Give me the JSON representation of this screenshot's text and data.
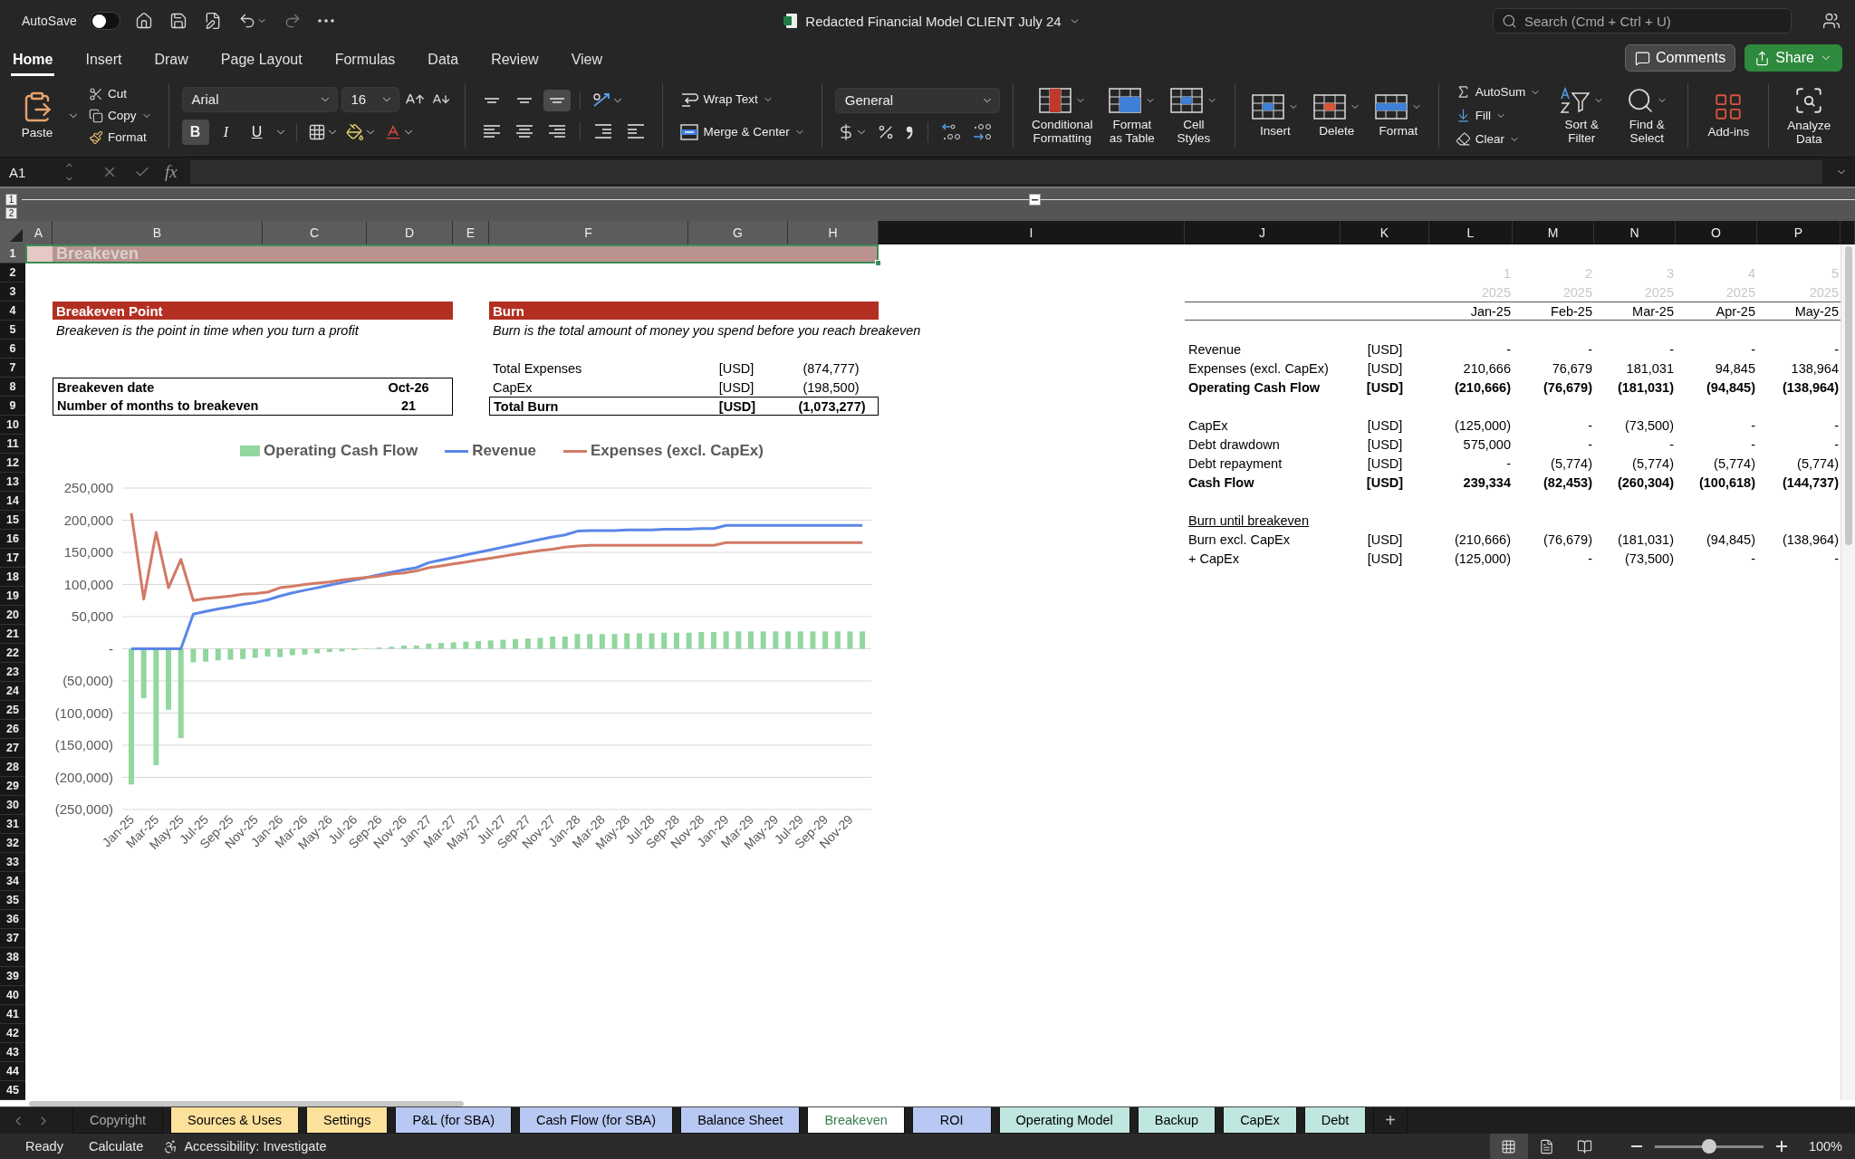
{
  "title_bar": {
    "autosave_label": "AutoSave",
    "autosave_on": false,
    "document_title": "Redacted Financial Model CLIENT July 24",
    "search_placeholder": "Search (Cmd + Ctrl + U)"
  },
  "ribbon_tabs": [
    {
      "label": "Home",
      "selected": true
    },
    {
      "label": "Insert",
      "selected": false
    },
    {
      "label": "Draw",
      "selected": false
    },
    {
      "label": "Page Layout",
      "selected": false
    },
    {
      "label": "Formulas",
      "selected": false
    },
    {
      "label": "Data",
      "selected": false
    },
    {
      "label": "Review",
      "selected": false
    },
    {
      "label": "View",
      "selected": false
    }
  ],
  "ribbon_actions": {
    "comments": "Comments",
    "share": "Share"
  },
  "ribbon": {
    "clipboard": {
      "paste": "Paste",
      "cut": "Cut",
      "copy": "Copy",
      "format": "Format"
    },
    "font": {
      "name": "Arial",
      "size": "16",
      "bold": {
        "label": "B",
        "on": true
      },
      "italic": {
        "label": "I",
        "on": false
      },
      "underline": {
        "label": "U",
        "on": false
      }
    },
    "vertical_alignment": [
      {
        "selected": false
      },
      {
        "selected": false
      },
      {
        "selected": true
      }
    ],
    "wrap_text": "Wrap Text",
    "merge": "Merge & Center",
    "number_format": "General",
    "styles": [
      "Conditional Formatting",
      "Format as Table",
      "Cell Styles"
    ],
    "cells": [
      "Insert",
      "Delete",
      "Format"
    ],
    "editing": {
      "autosum": "AutoSum",
      "fill": "Fill",
      "clear": "Clear",
      "sort": "Sort & Filter",
      "find": "Find & Select"
    },
    "addins": "Add-ins",
    "analyze": "Analyze Data"
  },
  "formula_bar": {
    "name_box": "A1",
    "fx": "fx"
  },
  "outline_levels": [
    "1",
    "2"
  ],
  "columns": [
    {
      "label": "A",
      "selected": true
    },
    {
      "label": "B",
      "selected": true
    },
    {
      "label": "C",
      "selected": true
    },
    {
      "label": "D",
      "selected": true
    },
    {
      "label": "E",
      "selected": true
    },
    {
      "label": "F",
      "selected": true
    },
    {
      "label": "G",
      "selected": true
    },
    {
      "label": "H",
      "selected": true
    },
    {
      "label": "I",
      "selected": false
    },
    {
      "label": "J",
      "selected": false
    },
    {
      "label": "K",
      "selected": false
    },
    {
      "label": "L",
      "selected": false
    },
    {
      "label": "M",
      "selected": false
    },
    {
      "label": "N",
      "selected": false
    },
    {
      "label": "O",
      "selected": false
    },
    {
      "label": "P",
      "selected": false
    }
  ],
  "rows": [
    {
      "label": "1",
      "selected": true
    },
    {
      "label": "2",
      "selected": false
    },
    {
      "label": "3",
      "selected": false
    },
    {
      "label": "4",
      "selected": false
    },
    {
      "label": "5",
      "selected": false
    },
    {
      "label": "6",
      "selected": false
    },
    {
      "label": "7",
      "selected": false
    },
    {
      "label": "8",
      "selected": false
    },
    {
      "label": "9",
      "selected": false
    },
    {
      "label": "10",
      "selected": false
    },
    {
      "label": "11",
      "selected": false
    },
    {
      "label": "12",
      "selected": false
    },
    {
      "label": "13",
      "selected": false
    },
    {
      "label": "14",
      "selected": false
    },
    {
      "label": "15",
      "selected": false
    },
    {
      "label": "16",
      "selected": false
    },
    {
      "label": "17",
      "selected": false
    },
    {
      "label": "18",
      "selected": false
    },
    {
      "label": "19",
      "selected": false
    },
    {
      "label": "20",
      "selected": false
    },
    {
      "label": "21",
      "selected": false
    },
    {
      "label": "22",
      "selected": false
    },
    {
      "label": "23",
      "selected": false
    },
    {
      "label": "24",
      "selected": false
    },
    {
      "label": "25",
      "selected": false
    },
    {
      "label": "26",
      "selected": false
    },
    {
      "label": "27",
      "selected": false
    },
    {
      "label": "28",
      "selected": false
    },
    {
      "label": "29",
      "selected": false
    },
    {
      "label": "30",
      "selected": false
    },
    {
      "label": "31",
      "selected": false
    },
    {
      "label": "32",
      "selected": false
    },
    {
      "label": "33",
      "selected": false
    },
    {
      "label": "34",
      "selected": false
    },
    {
      "label": "35",
      "selected": false
    },
    {
      "label": "36",
      "selected": false
    },
    {
      "label": "37",
      "selected": false
    },
    {
      "label": "38",
      "selected": false
    },
    {
      "label": "39",
      "selected": false
    },
    {
      "label": "40",
      "selected": false
    },
    {
      "label": "41",
      "selected": false
    },
    {
      "label": "42",
      "selected": false
    },
    {
      "label": "43",
      "selected": false
    },
    {
      "label": "44",
      "selected": false
    },
    {
      "label": "45",
      "selected": false
    }
  ],
  "sheet_title": "Breakeven",
  "breakeven_point": {
    "title": "Breakeven Point",
    "description": "Breakeven is the point in time when you turn a profit",
    "rows": [
      {
        "label": "Breakeven date",
        "value": "Oct-26"
      },
      {
        "label": "Number of months to breakeven",
        "value": "21"
      }
    ]
  },
  "burn": {
    "title": "Burn",
    "description": "Burn is the total amount of money you spend before you reach breakeven",
    "rows": [
      {
        "label": "Total Expenses",
        "unit": "[USD]",
        "value": "(874,777)",
        "total": false
      },
      {
        "label": "CapEx",
        "unit": "[USD]",
        "value": "(198,500)",
        "total": false
      },
      {
        "label": "Total Burn",
        "unit": "[USD]",
        "value": "(1,073,277)",
        "total": true
      }
    ]
  },
  "monthly_table": {
    "period_numbers": [
      "1",
      "2",
      "3",
      "4",
      "5"
    ],
    "years": [
      "2025",
      "2025",
      "2025",
      "2025",
      "2025"
    ],
    "months": [
      "Jan-25",
      "Feb-25",
      "Mar-25",
      "Apr-25",
      "May-25"
    ],
    "rows": [
      {
        "kind": "data",
        "label": "Revenue",
        "unit": "[USD]",
        "bold": false,
        "values": [
          "-",
          "-",
          "-",
          "-",
          "-"
        ]
      },
      {
        "kind": "data",
        "label": "Expenses (excl. CapEx)",
        "unit": "[USD]",
        "bold": false,
        "values": [
          "210,666",
          "76,679",
          "181,031",
          "94,845",
          "138,964"
        ]
      },
      {
        "kind": "data",
        "label": "Operating Cash Flow",
        "unit": "[USD]",
        "bold": true,
        "values": [
          "(210,666)",
          "(76,679)",
          "(181,031)",
          "(94,845)",
          "(138,964)"
        ]
      },
      {
        "kind": "spacer"
      },
      {
        "kind": "data",
        "label": "CapEx",
        "unit": "[USD]",
        "bold": false,
        "values": [
          "(125,000)",
          "-",
          "(73,500)",
          "-",
          "-"
        ]
      },
      {
        "kind": "data",
        "label": "Debt drawdown",
        "unit": "[USD]",
        "bold": false,
        "values": [
          "575,000",
          "-",
          "-",
          "-",
          "-"
        ]
      },
      {
        "kind": "data",
        "label": "Debt repayment",
        "unit": "[USD]",
        "bold": false,
        "values": [
          "-",
          "(5,774)",
          "(5,774)",
          "(5,774)",
          "(5,774)"
        ]
      },
      {
        "kind": "data",
        "label": "Cash Flow",
        "unit": "[USD]",
        "bold": true,
        "values": [
          "239,334",
          "(82,453)",
          "(260,304)",
          "(100,618)",
          "(144,737)"
        ]
      },
      {
        "kind": "spacer"
      },
      {
        "kind": "heading",
        "label": "Burn until breakeven"
      },
      {
        "kind": "data",
        "label": "Burn excl. CapEx",
        "unit": "[USD]",
        "bold": false,
        "values": [
          "(210,666)",
          "(76,679)",
          "(181,031)",
          "(94,845)",
          "(138,964)"
        ]
      },
      {
        "kind": "data",
        "label": "+ CapEx",
        "unit": "[USD]",
        "bold": false,
        "values": [
          "(125,000)",
          "-",
          "(73,500)",
          "-",
          "-"
        ]
      }
    ]
  },
  "chart": {
    "chart_data": {
      "type": "bar",
      "ylim": [
        -250000,
        250000
      ],
      "yticks": [
        {
          "value": 250000,
          "label": "250,000"
        },
        {
          "value": 200000,
          "label": "200,000"
        },
        {
          "value": 150000,
          "label": "150,000"
        },
        {
          "value": 100000,
          "label": "100,000"
        },
        {
          "value": 50000,
          "label": "50,000"
        },
        {
          "value": 0,
          "label": "-"
        },
        {
          "value": -50000,
          "label": "(50,000)"
        },
        {
          "value": -100000,
          "label": "(100,000)"
        },
        {
          "value": -150000,
          "label": "(150,000)"
        },
        {
          "value": -200000,
          "label": "(200,000)"
        },
        {
          "value": -250000,
          "label": "(250,000)"
        }
      ],
      "grid": true,
      "legend": true,
      "categories": [
        "Jan-25",
        null,
        "Mar-25",
        null,
        "May-25",
        null,
        "Jul-25",
        null,
        "Sep-25",
        null,
        "Nov-25",
        null,
        "Jan-26",
        null,
        "Mar-26",
        null,
        "May-26",
        null,
        "Jul-26",
        null,
        "Sep-26",
        null,
        "Nov-26",
        null,
        "Jan-27",
        null,
        "Mar-27",
        null,
        "May-27",
        null,
        "Jul-27",
        null,
        "Sep-27",
        null,
        "Nov-27",
        null,
        "Jan-28",
        null,
        "Mar-28",
        null,
        "May-28",
        null,
        "Jul-28",
        null,
        "Sep-28",
        null,
        "Nov-28",
        null,
        "Jan-29",
        null,
        "Mar-29",
        null,
        "May-29",
        null,
        "Jul-29",
        null,
        "Sep-29",
        null,
        "Nov-29",
        null
      ],
      "series": [
        {
          "name": "Operating Cash Flow",
          "type": "bar",
          "color": "#92d6a0",
          "values": [
            -211000,
            -77000,
            -181000,
            -95000,
            -139000,
            -21000,
            -20000,
            -18000,
            -17000,
            -16000,
            -14000,
            -12000,
            -13000,
            -10000,
            -9000,
            -7000,
            -5000,
            -4000,
            -2000,
            0,
            2000,
            3000,
            5000,
            5000,
            8000,
            9000,
            10000,
            11000,
            12000,
            13000,
            14000,
            15000,
            16000,
            17000,
            19000,
            19000,
            23000,
            23000,
            23000,
            23000,
            24000,
            24000,
            24000,
            25000,
            25000,
            25000,
            26000,
            26000,
            27000,
            27000,
            27000,
            27000,
            27000,
            27000,
            27000,
            27000,
            27000,
            27000,
            27000,
            27000
          ]
        },
        {
          "name": "Revenue",
          "type": "line",
          "color": "#5a86e8",
          "values": [
            0,
            0,
            0,
            0,
            0,
            54000,
            58000,
            62000,
            65000,
            69000,
            72000,
            76000,
            82000,
            87000,
            91000,
            95000,
            99000,
            103000,
            107000,
            111000,
            115000,
            119000,
            123000,
            126000,
            134000,
            138000,
            142000,
            146000,
            150000,
            154000,
            158000,
            162000,
            166000,
            170000,
            174000,
            177000,
            183000,
            184000,
            184000,
            184000,
            185000,
            185000,
            185000,
            186000,
            186000,
            186000,
            187000,
            187000,
            192000,
            192000,
            192000,
            192000,
            192000,
            192000,
            192000,
            192000,
            192000,
            192000,
            192000,
            192000
          ]
        },
        {
          "name": "Expenses (excl. CapEx)",
          "type": "line",
          "color": "#d27a66",
          "values": [
            211000,
            77000,
            181000,
            95000,
            139000,
            75000,
            78000,
            80000,
            82000,
            85000,
            86000,
            88000,
            95000,
            97000,
            100000,
            102000,
            104000,
            107000,
            109000,
            111000,
            113000,
            116000,
            118000,
            121000,
            126000,
            129000,
            132000,
            135000,
            138000,
            141000,
            144000,
            147000,
            150000,
            153000,
            155000,
            158000,
            160000,
            161000,
            161000,
            161000,
            161000,
            161000,
            161000,
            161000,
            161000,
            161000,
            161000,
            161000,
            165000,
            165000,
            165000,
            165000,
            165000,
            165000,
            165000,
            165000,
            165000,
            165000,
            165000,
            165000
          ]
        }
      ]
    }
  },
  "sheet_tabs": [
    {
      "label": "Copyright",
      "selected": false
    },
    {
      "label": "Sources & Uses",
      "selected": false,
      "color": "#fbe19b"
    },
    {
      "label": "Settings",
      "selected": false,
      "color": "#fbe19b"
    },
    {
      "label": "P&L (for SBA)",
      "selected": false,
      "color": "#b7c8f2"
    },
    {
      "label": "Cash Flow (for SBA)",
      "selected": false,
      "color": "#b7c8f2"
    },
    {
      "label": "Balance Sheet",
      "selected": false,
      "color": "#b7c8f2"
    },
    {
      "label": "Breakeven",
      "selected": true
    },
    {
      "label": "ROI",
      "selected": false,
      "color": "#b7c8f2"
    },
    {
      "label": "Operating Model",
      "selected": false,
      "color": "#bfe6df"
    },
    {
      "label": "Backup",
      "selected": false,
      "color": "#bfe6df"
    },
    {
      "label": "CapEx",
      "selected": false,
      "color": "#bfe6df"
    },
    {
      "label": "Debt",
      "selected": false,
      "color": "#bfe6df"
    }
  ],
  "add_sheet": "+",
  "status_bar": {
    "ready": "Ready",
    "calculate": "Calculate",
    "accessibility": "Accessibility: Investigate",
    "views": [
      {
        "selected": true
      },
      {
        "selected": false
      },
      {
        "selected": false
      }
    ],
    "zoom": {
      "level": 0.5,
      "reading": "100%"
    }
  }
}
